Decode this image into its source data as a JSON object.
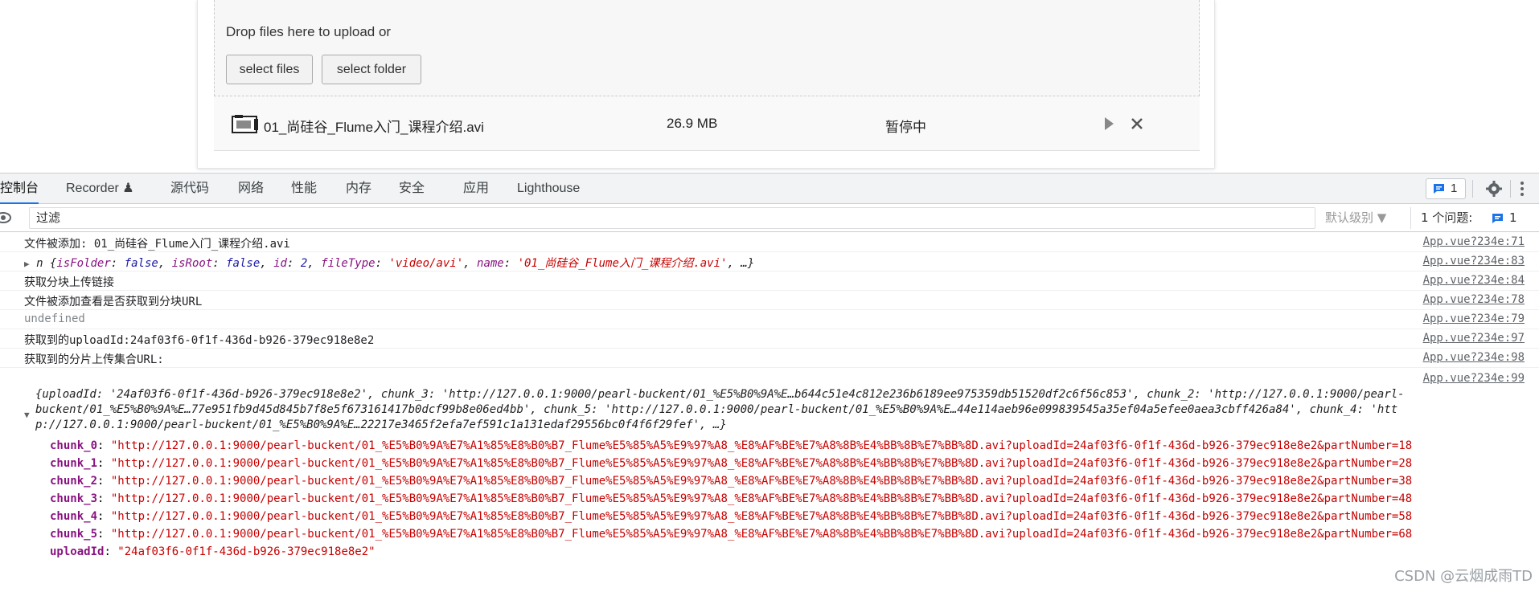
{
  "uploader": {
    "drop_text": "Drop files here to upload or",
    "select_files": "select files",
    "select_folder": "select folder",
    "file": {
      "name": "01_尚硅谷_Flume入门_课程介绍.avi",
      "size": "26.9 MB",
      "status": "暂停中"
    }
  },
  "devtools": {
    "tabs": [
      {
        "label": "控制台"
      },
      {
        "label": "Recorder ♟"
      },
      {
        "label": "源代码"
      },
      {
        "label": "网络"
      },
      {
        "label": "性能"
      },
      {
        "label": "内存"
      },
      {
        "label": "安全"
      },
      {
        "label": "应用"
      },
      {
        "label": "Lighthouse"
      }
    ],
    "issues_badge": "1",
    "filter_placeholder": "过滤",
    "level_select": "默认级别 ▼",
    "issues_count_label": "1 个问题:",
    "issues_count": "1",
    "accent_color": "#1a73e8"
  },
  "console": {
    "logs": [
      {
        "text": "文件被添加: 01_尚硅谷_Flume入门_课程介绍.avi",
        "src": "App.vue?234e:71"
      },
      {
        "text": "",
        "src": "App.vue?234e:83"
      },
      {
        "text": "获取分块上传链接",
        "src": "App.vue?234e:84"
      },
      {
        "text": "文件被添加查看是否获取到分块URL",
        "src": "App.vue?234e:78"
      },
      {
        "text": "undefined",
        "src": "App.vue?234e:79"
      },
      {
        "text": "获取到的uploadId:24af03f6-0f1f-436d-b926-379ec918e8e2",
        "src": "App.vue?234e:97"
      },
      {
        "text": "获取到的分片上传集合URL:",
        "src": "App.vue?234e:98"
      },
      {
        "text": "",
        "src": "App.vue?234e:99"
      }
    ],
    "file_obj": {
      "prefix": "n {",
      "isFolder_key": "isFolder",
      "isFolder_val": "false",
      "isRoot_key": "isRoot",
      "isRoot_val": "false",
      "id_key": "id",
      "id_val": "2",
      "fileType_key": "fileType",
      "fileType_val": "'video/avi'",
      "name_key": "name",
      "name_val": "'01_尚硅谷_Flume入门_课程介绍.avi'",
      "suffix": ", …}"
    },
    "upload_obj_preview": [
      "{uploadId: '24af03f6-0f1f-436d-b926-379ec918e8e2', chunk_3: 'http://127.0.0.1:9000/pearl-buckent/01_%E5%B0%9A%E…b644c51e4c812e236b6189ee975359db51520df2c6f56c853', chunk_2: 'http://127.0.0.1:9000/pearl-",
      "buckent/01_%E5%B0%9A%E…77e951fb9d45d845b7f8e5f673161417b0dcf99b8e06ed4bb', chunk_5: 'http://127.0.0.1:9000/pearl-buckent/01_%E5%B0%9A%E…44e114aeb96e099839545a35ef04a5efee0aea3cbff426a84', chunk_4: 'htt",
      "p://127.0.0.1:9000/pearl-buckent/01_%E5%B0%9A%E…22217e3465f2efa7ef591c1a131edaf29556bc0f4f6f29fef', …}"
    ],
    "chunks": [
      {
        "key": "chunk_0",
        "value": "\"http://127.0.0.1:9000/pearl-buckent/01_%E5%B0%9A%E7%A1%85%E8%B0%B7_Flume%E5%85%A5%E9%97%A8_%E8%AF%BE%E7%A8%8B%E4%BB%8B%E7%BB%8D.avi?uploadId=24af03f6-0f1f-436d-b926-379ec918e8e2&partNumber=18"
      },
      {
        "key": "chunk_1",
        "value": "\"http://127.0.0.1:9000/pearl-buckent/01_%E5%B0%9A%E7%A1%85%E8%B0%B7_Flume%E5%85%A5%E9%97%A8_%E8%AF%BE%E7%A8%8B%E4%BB%8B%E7%BB%8D.avi?uploadId=24af03f6-0f1f-436d-b926-379ec918e8e2&partNumber=28"
      },
      {
        "key": "chunk_2",
        "value": "\"http://127.0.0.1:9000/pearl-buckent/01_%E5%B0%9A%E7%A1%85%E8%B0%B7_Flume%E5%85%A5%E9%97%A8_%E8%AF%BE%E7%A8%8B%E4%BB%8B%E7%BB%8D.avi?uploadId=24af03f6-0f1f-436d-b926-379ec918e8e2&partNumber=38"
      },
      {
        "key": "chunk_3",
        "value": "\"http://127.0.0.1:9000/pearl-buckent/01_%E5%B0%9A%E7%A1%85%E8%B0%B7_Flume%E5%85%A5%E9%97%A8_%E8%AF%BE%E7%A8%8B%E4%BB%8B%E7%BB%8D.avi?uploadId=24af03f6-0f1f-436d-b926-379ec918e8e2&partNumber=48"
      },
      {
        "key": "chunk_4",
        "value": "\"http://127.0.0.1:9000/pearl-buckent/01_%E5%B0%9A%E7%A1%85%E8%B0%B7_Flume%E5%85%A5%E9%97%A8_%E8%AF%BE%E7%A8%8B%E4%BB%8B%E7%BB%8D.avi?uploadId=24af03f6-0f1f-436d-b926-379ec918e8e2&partNumber=58"
      },
      {
        "key": "chunk_5",
        "value": "\"http://127.0.0.1:9000/pearl-buckent/01_%E5%B0%9A%E7%A1%85%E8%B0%B7_Flume%E5%85%A5%E9%97%A8_%E8%AF%BE%E7%A8%8B%E4%BB%8B%E7%BB%8D.avi?uploadId=24af03f6-0f1f-436d-b926-379ec918e8e2&partNumber=68"
      },
      {
        "key": "uploadId",
        "value": "\"24af03f6-0f1f-436d-b926-379ec918e8e2\""
      }
    ],
    "watermark": "CSDN @云烟成雨TD"
  }
}
